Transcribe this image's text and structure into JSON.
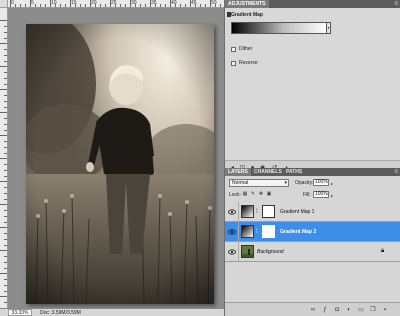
{
  "ruler": {
    "top_labels": [
      "0",
      "5",
      "10",
      "15",
      "20",
      "25",
      "30",
      "35",
      "40",
      "45",
      "50"
    ],
    "left_labels": [
      "0",
      "5",
      "10",
      "15",
      "20",
      "25",
      "30",
      "35",
      "40",
      "45",
      "50",
      "55",
      "60"
    ]
  },
  "status": {
    "zoom": "33.33%",
    "doc_info": "Doc: 3.59M/3.59M"
  },
  "adjustments_panel": {
    "tab_label": "ADJUSTMENTS",
    "title": "Gradient Map",
    "gradient": {
      "stops": [
        "#000000",
        "#bdbdbd",
        "#ffffff"
      ]
    },
    "options": [
      {
        "label": "Dither",
        "checked": false
      },
      {
        "label": "Reverse",
        "checked": false
      }
    ]
  },
  "layers_panel": {
    "tabs": [
      "LAYERS",
      "CHANNELS",
      "PATHS"
    ],
    "active_tab": "LAYERS",
    "blend_mode": "Normal",
    "opacity_label": "Opacity:",
    "opacity_value": "100%",
    "lock_label": "Lock:",
    "fill_label": "Fill:",
    "fill_value": "100%",
    "layers": [
      {
        "name": "Gradient Map 1",
        "type": "adjustment",
        "visible": true,
        "selected": false
      },
      {
        "name": "Gradient Map 2",
        "type": "adjustment",
        "visible": true,
        "selected": true
      },
      {
        "name": "Background",
        "type": "pixel",
        "visible": true,
        "selected": false,
        "locked": true
      }
    ]
  },
  "colors": {
    "selection": "#3d8ee8",
    "panel_bg": "#d6d6d6",
    "tab_bar": "#5c5c5c",
    "canvas_bg": "#8c8c8c"
  }
}
